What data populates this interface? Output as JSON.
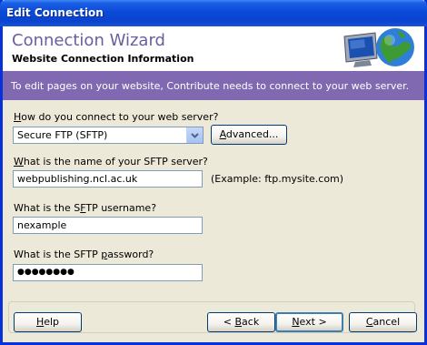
{
  "window": {
    "title": "Edit Connection"
  },
  "header": {
    "title": "Connection Wizard",
    "subtitle": "Website Connection Information",
    "graphic_icon": "computer-globe-icon"
  },
  "banner": {
    "text": "To edit pages on your website, Contribute needs to connect to your web server."
  },
  "connect_method": {
    "label_pre": "",
    "label_ul": "H",
    "label_post": "ow do you connect to your web server?",
    "selected": "Secure FTP (SFTP)",
    "advanced_pre": "",
    "advanced_ul": "A",
    "advanced_post": "dvanced..."
  },
  "server": {
    "label_pre": "",
    "label_ul": "W",
    "label_post": "hat is the name of your SFTP server?",
    "value": "webpublishing.ncl.ac.uk",
    "example": "(Example: ftp.mysite.com)"
  },
  "username": {
    "label_pre": "What is the S",
    "label_ul": "F",
    "label_post": "TP username?",
    "value": "nexample"
  },
  "password": {
    "label_pre": "What is the SFTP ",
    "label_ul": "p",
    "label_post": "assword?",
    "value": "●●●●●●●●"
  },
  "buttons": {
    "help_pre": "",
    "help_ul": "H",
    "help_post": "elp",
    "back_pre": "< ",
    "back_ul": "B",
    "back_post": "ack",
    "next_pre": "",
    "next_ul": "N",
    "next_post": "ext >",
    "cancel_pre": "",
    "cancel_ul": "C",
    "cancel_post": "ancel"
  },
  "colors": {
    "title_bar": "#0a4ad8",
    "banner": "#8069b0",
    "wizard_title": "#6b5e9e",
    "dialog_bg": "#ece9d8"
  }
}
